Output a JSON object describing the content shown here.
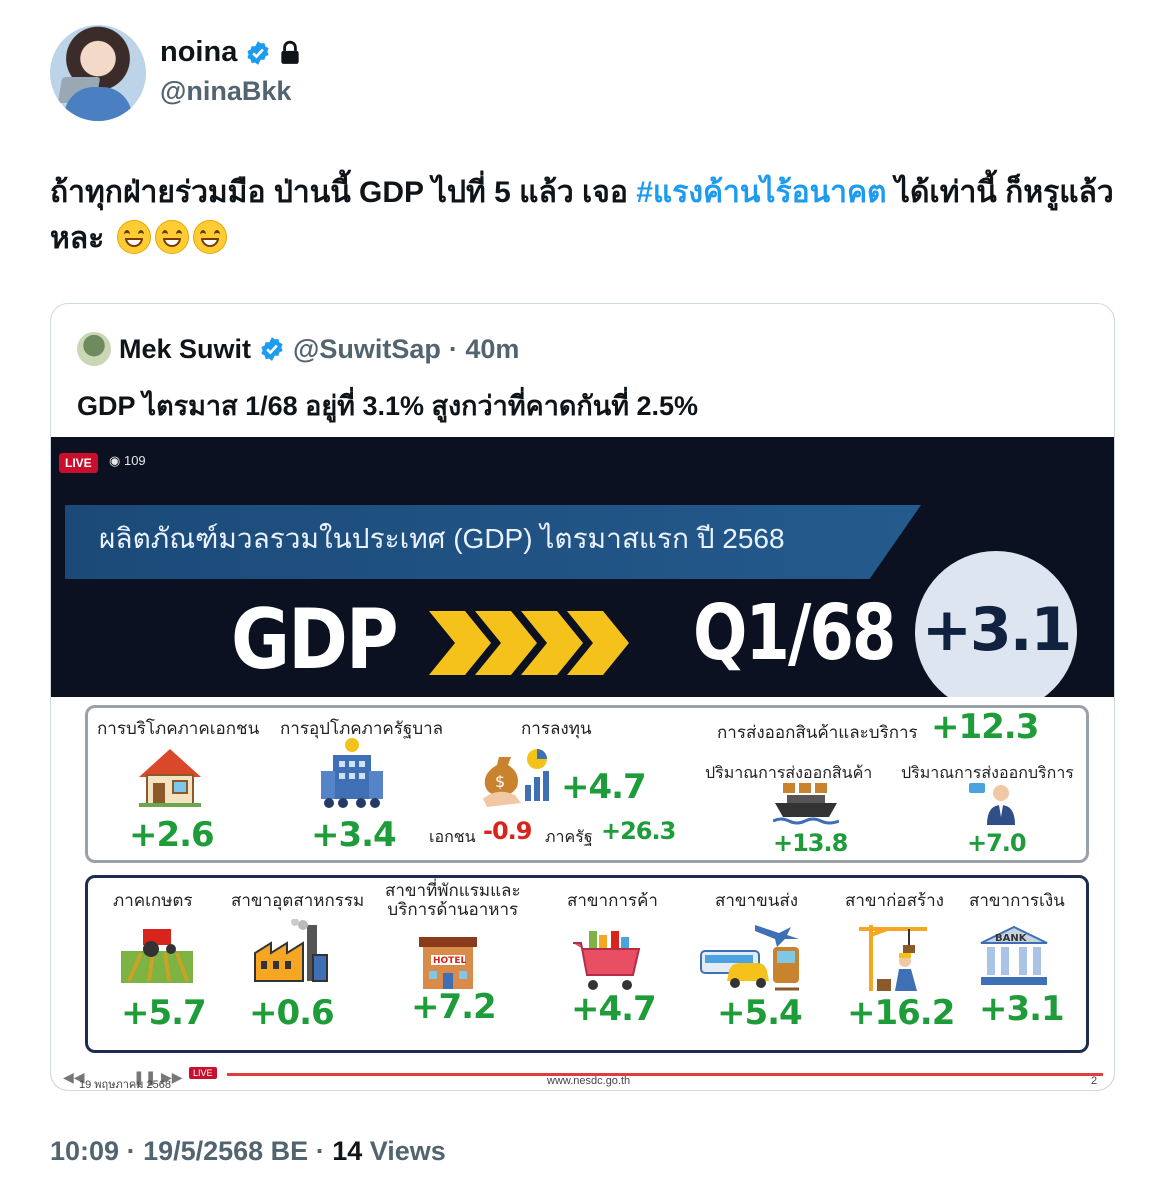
{
  "author": {
    "name": "noina",
    "handle": "@ninaBkk"
  },
  "tweet": {
    "text_before": "ถ้าทุกฝ่ายร่วมมือ ป่านนี้ GDP ไปที่ 5 แล้ว เจอ ",
    "hashtag": "#แรงค้านไร้อนาคต",
    "text_after": " ได้เท่านี้ ก็หรูแล้วหละ"
  },
  "quote": {
    "name": "Mek Suwit",
    "handle": "@SuwitSap",
    "time": "· 40m",
    "text": "GDP ไตรมาส 1/68 อยู่ที่ 3.1% สูงกว่าที่คาดกันที่ 2.5%"
  },
  "video": {
    "live": "LIVE",
    "viewers": "109",
    "banner": "ผลิตภัณฑ์มวลรวมในประเทศ (GDP) ไตรมาสแรก ปี 2568",
    "gdp_label": "GDP",
    "quarter": "Q1/68",
    "total": "+3.1",
    "top_row": {
      "private_consumption": {
        "label": "การบริโภคภาคเอกชน",
        "value": "+2.6"
      },
      "gov_consumption": {
        "label": "การอุปโภคภาครัฐบาล",
        "value": "+3.4"
      },
      "investment": {
        "label": "การลงทุน",
        "value": "+4.7",
        "private_label": "เอกชน",
        "private_value": "-0.9",
        "public_label": "ภาครัฐ",
        "public_value": "+26.3"
      },
      "exports": {
        "label": "การส่งออกสินค้าและบริการ",
        "value": "+12.3",
        "goods_label": "ปริมาณการส่งออกสินค้า",
        "goods_value": "+13.8",
        "services_label": "ปริมาณการส่งออกบริการ",
        "services_value": "+7.0"
      }
    },
    "sectors": [
      {
        "label": "ภาคเกษตร",
        "value": "+5.7",
        "icon": "tractor-icon"
      },
      {
        "label": "สาขาอุตสาหกรรม",
        "value": "+0.6",
        "icon": "factory-icon"
      },
      {
        "label": "สาขาที่พักแรมและ",
        "label2": "บริการด้านอาหาร",
        "value": "+7.2",
        "icon": "hotel-icon"
      },
      {
        "label": "สาขาการค้า",
        "value": "+4.7",
        "icon": "shopping-cart-icon"
      },
      {
        "label": "สาขาขนส่ง",
        "value": "+5.4",
        "icon": "transport-icon"
      },
      {
        "label": "สาขาก่อสร้าง",
        "value": "+16.2",
        "icon": "construction-crane-icon"
      },
      {
        "label": "สาขาการเงิน",
        "value": "+3.1",
        "icon": "bank-icon",
        "icon_text": "BANK"
      }
    ],
    "hotel_sign": "HOTEL",
    "footer_date": "19 พฤษภาคม 2568",
    "footer_url": "www.nesdc.go.th",
    "footer_page": "2"
  },
  "meta": {
    "time": "10:09",
    "date": "19/5/2568 BE",
    "views_count": "14",
    "views_label": "Views"
  },
  "colors": {
    "verified": "#1d9bf0",
    "hashtag": "#1d9bf0",
    "positive": "#1f9c3a",
    "negative": "#d9241c",
    "live": "#c8102e"
  }
}
